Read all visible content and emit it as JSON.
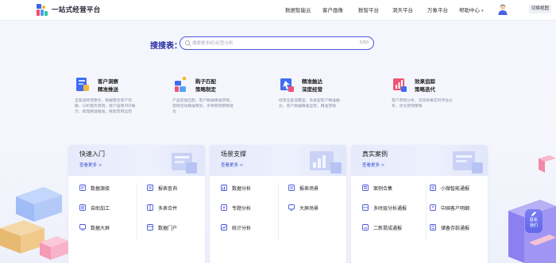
{
  "header": {
    "brand": "一站式经营平台",
    "nav": [
      "数据智能云",
      "客户画像",
      "数智平台",
      "洞天平台",
      "万象平台"
    ],
    "help": "帮助中心",
    "switch_label": "切换视图"
  },
  "search": {
    "label": "搜搜表：",
    "placeholder": "搜索更多好/经营分析",
    "count": "0/50"
  },
  "features": [
    {
      "title1": "客户洞察",
      "title2": "精准推送",
      "desc": "全渠道经营整合，数据整合客户洞察，分析服务营销，客户画像360展示，助理精准推送，赋能营销运营"
    },
    {
      "title1": "购子匹配",
      "title2": "策略制定",
      "desc": "产品智能匹配，客户数据精准营销，营销活动精准策划，多种营销策略组合"
    },
    {
      "title1": "精准触达",
      "title2": "深度经营",
      "desc": "经营全渠道覆盖，多类型客户精准触达，客户数据精准运营，精准营销"
    },
    {
      "title1": "效果追踪",
      "title2": "策略迭代",
      "desc": "客户营销分析，活动效果实时评估分析，优化营销策略"
    }
  ],
  "cards": [
    {
      "title": "快速入门",
      "more": "查看更多 >",
      "items": [
        "数据源接",
        "报表查询",
        "自助加工",
        "多表合并",
        "数据大屏",
        "数据门户"
      ]
    },
    {
      "title": "场景支撑",
      "more": "查看更多 >",
      "items": [
        "数据分析",
        "报表场景",
        "专题分析",
        "大屏场景",
        "统计分析"
      ]
    },
    {
      "title": "真实案例",
      "more": "查看更多 >",
      "items": [
        "案例合集",
        "小微智能通报",
        "多时层分析通报",
        "中国客户明细",
        "二新提成通报",
        "储备存款通报"
      ]
    }
  ],
  "float_button": "联系\n我们",
  "colors": {
    "accent": "#4a55d8",
    "label": "#2b2fa3",
    "link": "#3c4fd0"
  }
}
